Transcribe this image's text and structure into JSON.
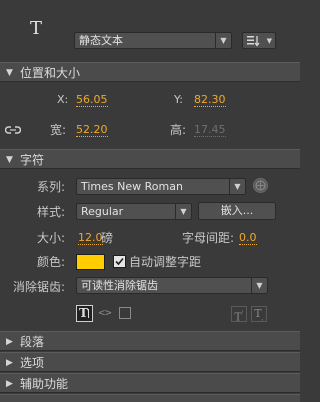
{
  "header": {
    "tool_icon": "T",
    "text_type": "静态文本",
    "orientation_icon": "text-orientation-icon"
  },
  "position_size": {
    "title": "位置和大小",
    "x_label": "X:",
    "x_value": "56.05",
    "y_label": "Y:",
    "y_value": "82.30",
    "width_label": "宽:",
    "width_value": "52.20",
    "height_label": "高:",
    "height_value": "17.45",
    "link_icon": "link-icon"
  },
  "character": {
    "title": "字符",
    "family_label": "系列:",
    "family_value": "Times New Roman",
    "style_label": "样式:",
    "style_value": "Regular",
    "embed_label": "嵌入...",
    "size_label": "大小:",
    "size_value": "12.0",
    "size_unit": "磅",
    "spacing_label": "字母间距:",
    "spacing_value": "0.0",
    "color_label": "颜色:",
    "color_value": "#FFCC00",
    "autokern_label": "自动调整字距",
    "autokern_checked": true,
    "aa_label": "消除锯齿:",
    "aa_value": "可读性消除锯齿"
  },
  "collapsed_sections": [
    {
      "title": "段落"
    },
    {
      "title": "选项"
    },
    {
      "title": "辅助功能"
    }
  ],
  "colors": {
    "panel_bg": "#3a3a3a",
    "section_bg": "#4b4b4b",
    "accent_orange": "#f0a92b"
  }
}
